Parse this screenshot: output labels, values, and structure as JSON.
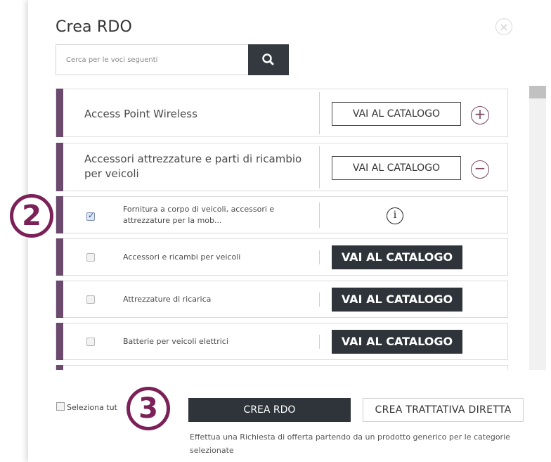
{
  "dialog": {
    "title": "Crea RDO",
    "close_icon": "×"
  },
  "search": {
    "placeholder": "Cerca per le voci seguenti",
    "button_icon": "search-icon"
  },
  "categories": [
    {
      "label": "Access Point Wireless",
      "button": "VAI AL CATALOGO",
      "toggle": "+"
    },
    {
      "label": "Accessori attrezzature e parti di ricambio per veicoli",
      "button": "VAI AL CATALOGO",
      "toggle": "−"
    }
  ],
  "subitems": [
    {
      "label": "Fornitura a corpo di veicoli, accessori e attrezzature per la mob...",
      "checked": true,
      "info_icon": "i"
    },
    {
      "label": "Accessori e ricambi per veicoli",
      "checked": false,
      "button": "VAI AL CATALOGO"
    },
    {
      "label": "Attrezzature di ricarica",
      "checked": false,
      "button": "VAI AL CATALOGO"
    },
    {
      "label": "Batterie per veicoli elettrici",
      "checked": false,
      "button": "VAI AL CATALOGO"
    }
  ],
  "footer": {
    "select_all": "Seleziona tut",
    "crea_rdo": "CREA RDO",
    "crea_trattativa": "CREA TRATTATIVA DIRETTA",
    "note": "Effettua una Richiesta di offerta partendo da un prodotto generico per le categorie selezionate"
  },
  "markers": {
    "step2": "2",
    "step3": "3"
  },
  "colors": {
    "accent_bar": "#6b4a6e",
    "dark_button": "#2f343a",
    "marker": "#7b2158"
  }
}
